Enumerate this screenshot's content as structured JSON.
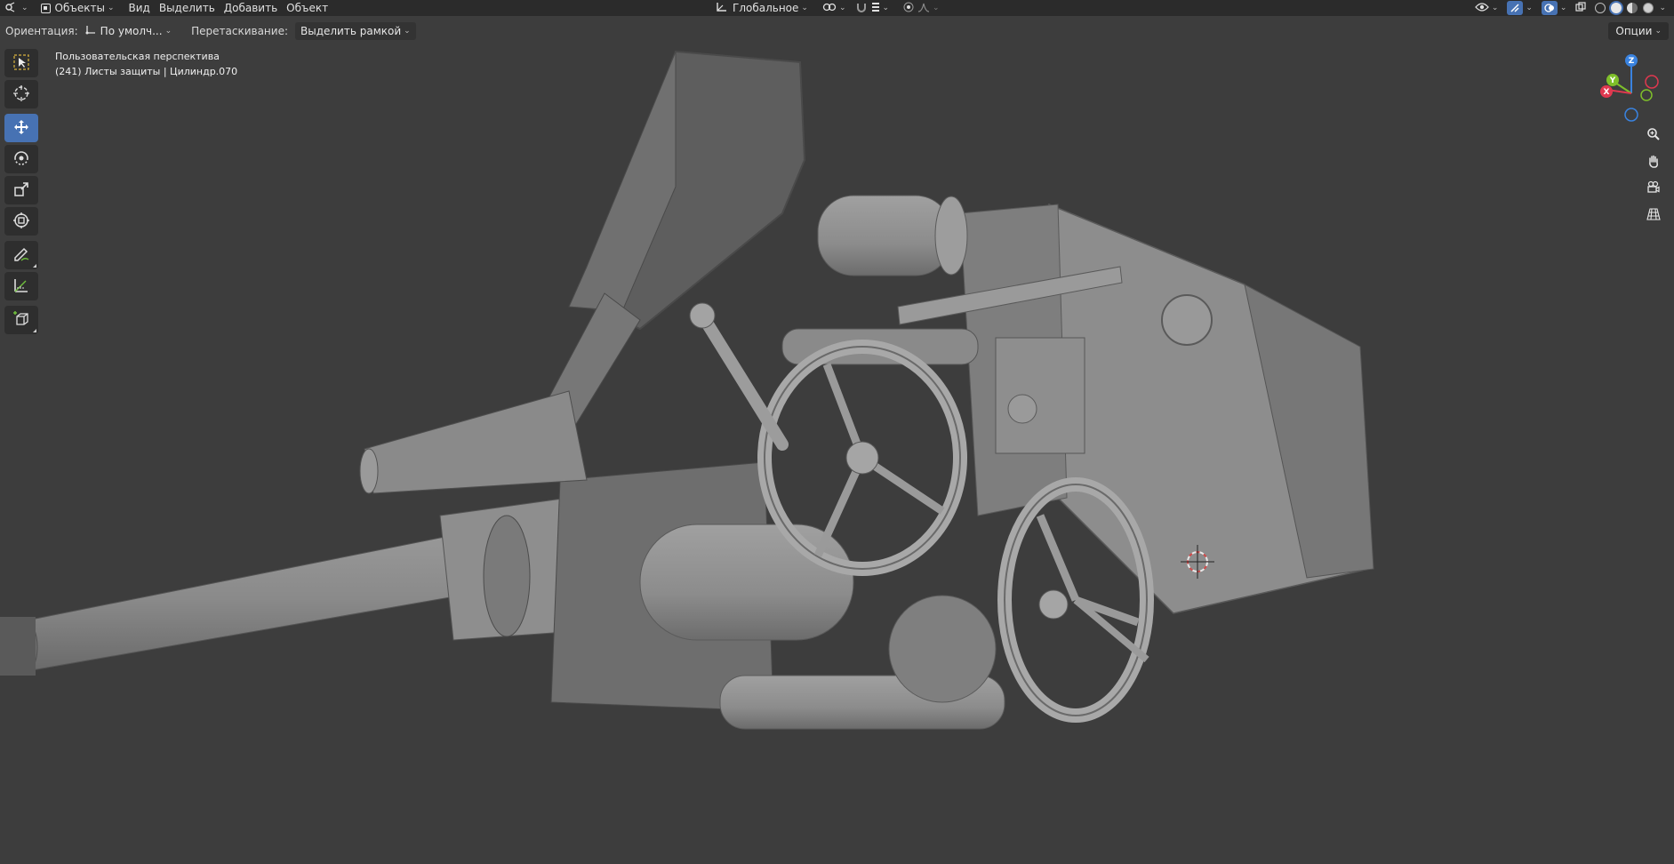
{
  "header": {
    "editor_icon": "3d-viewport-icon",
    "mode": "Объекты",
    "menus": [
      "Вид",
      "Выделить",
      "Добавить",
      "Объект"
    ],
    "transform_orientation": "Глобальное"
  },
  "tool_settings": {
    "orientation_label": "Ориентация:",
    "orientation_value": "По умолч...",
    "drag_label": "Перетаскивание:",
    "drag_value": "Выделить рамкой",
    "options": "Опции"
  },
  "tools": [
    {
      "name": "select-box-tool",
      "icon": "select-box-icon",
      "active": false
    },
    {
      "name": "cursor-tool",
      "icon": "cursor-icon",
      "active": false
    },
    {
      "name": "move-tool",
      "icon": "move-icon",
      "active": true
    },
    {
      "name": "rotate-tool",
      "icon": "rotate-icon",
      "active": false
    },
    {
      "name": "scale-tool",
      "icon": "scale-icon",
      "active": false
    },
    {
      "name": "transform-tool",
      "icon": "transform-icon",
      "active": false
    },
    {
      "name": "annotate-tool",
      "icon": "annotate-icon",
      "active": false
    },
    {
      "name": "measure-tool",
      "icon": "measure-icon",
      "active": false
    },
    {
      "name": "add-cube-tool",
      "icon": "add-cube-icon",
      "active": false
    }
  ],
  "viewport": {
    "view_name": "Пользовательская перспектива",
    "info": "(241) Листы защиты | Цилиндр.070"
  },
  "gizmo": {
    "x": "X",
    "y": "Y",
    "z": "Z"
  },
  "colors": {
    "background": "#3d3d3d",
    "header": "#2b2b2b",
    "accent": "#4772b3",
    "axis_x": "#e0384f",
    "axis_y": "#7fbf2a",
    "axis_z": "#3a83e0"
  }
}
